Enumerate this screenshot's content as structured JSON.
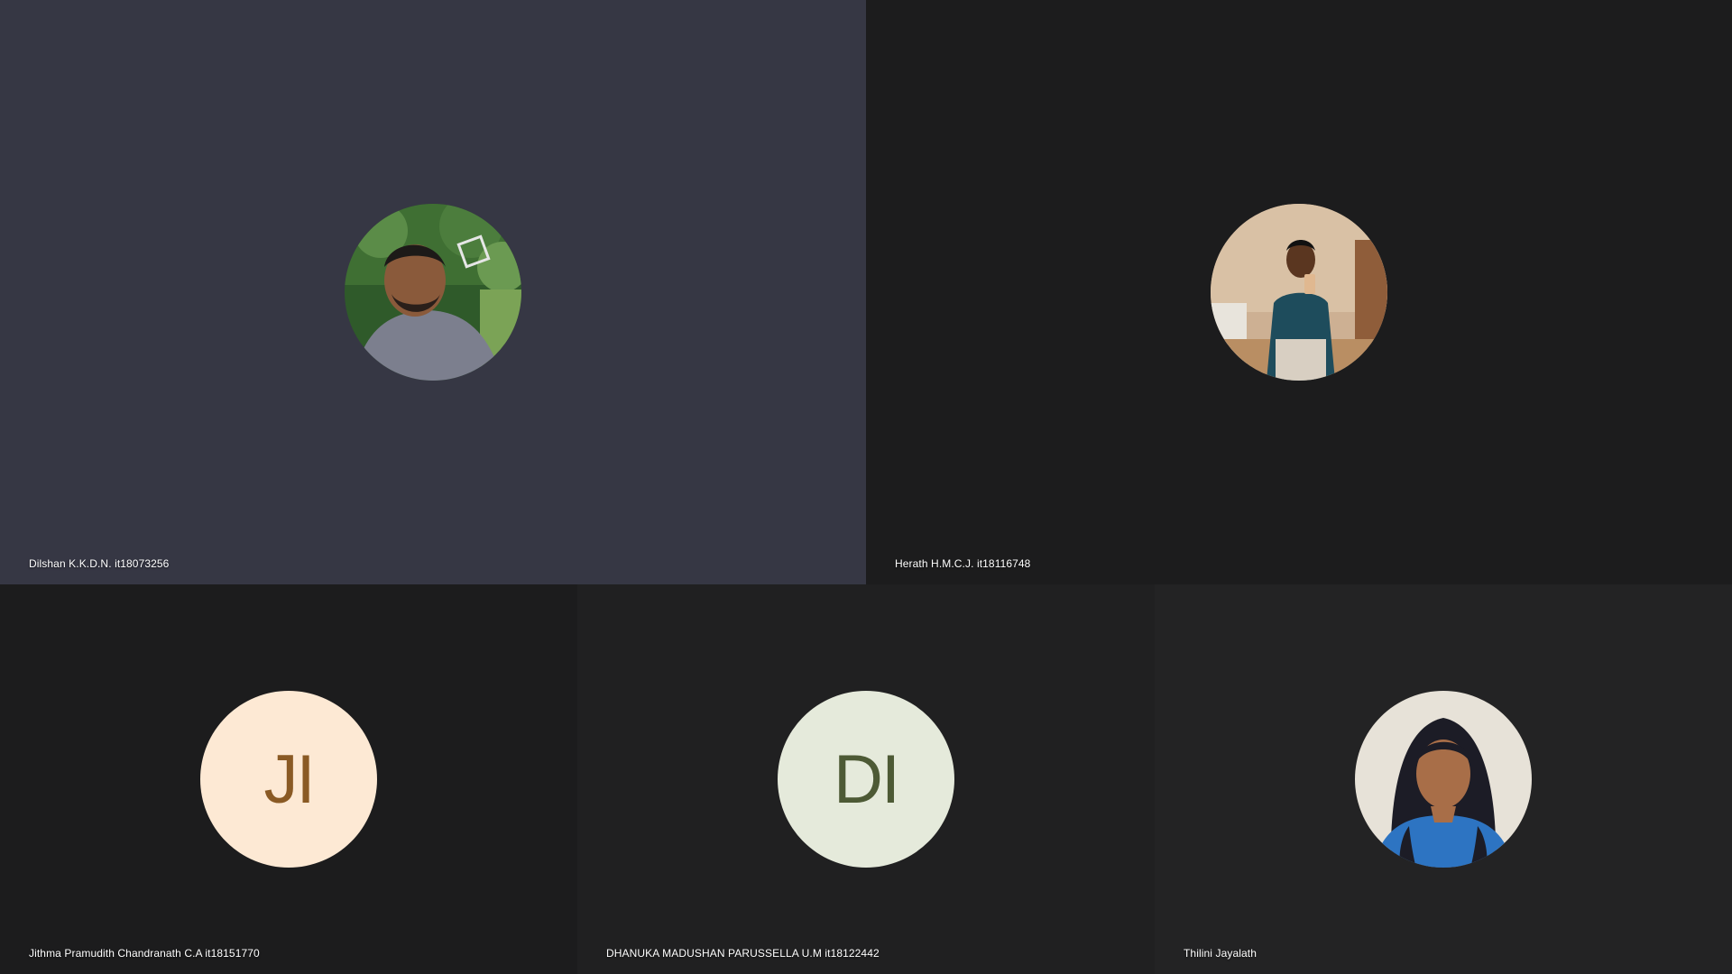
{
  "participants": [
    {
      "name": "Dilshan K.K.D.N. it18073256",
      "tile_color": "#363744",
      "avatar": "photo-man-outdoors"
    },
    {
      "name": "Herath H.M.C.J. it18116748",
      "tile_color": "#1c1c1d",
      "avatar": "photo-man-mirror-selfie"
    },
    {
      "name": "Jithma Pramudith Chandranath C.A it18151770",
      "tile_color": "#1c1c1d",
      "initials": "JI",
      "avatar_bg": "#fde9d4",
      "initials_color": "#8a5a24"
    },
    {
      "name": "DHANUKA MADUSHAN PARUSSELLA U.M it18122442",
      "tile_color": "#202021",
      "initials": "DI",
      "avatar_bg": "#e5eadb",
      "initials_color": "#4d5a35"
    },
    {
      "name": "Thilini Jayalath",
      "tile_color": "#232324",
      "avatar": "photo-woman-portrait"
    }
  ]
}
